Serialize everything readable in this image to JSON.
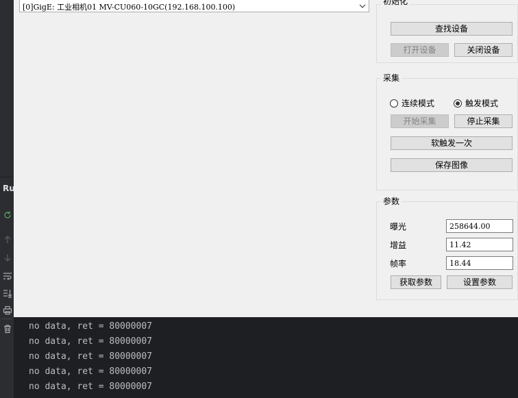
{
  "ide": {
    "run_label": "Ru"
  },
  "device": {
    "selected": "[0]GigE: 工业相机01 MV-CU060-10GC(192.168.100.100)"
  },
  "init_group": {
    "title": "初始化",
    "find_device": "查找设备",
    "open_device": "打开设备",
    "close_device": "关闭设备"
  },
  "acq_group": {
    "title": "采集",
    "continuous_mode": "连续模式",
    "trigger_mode": "触发模式",
    "start_grab": "开始采集",
    "stop_grab": "停止采集",
    "soft_trigger": "软触发一次",
    "save_image": "保存图像"
  },
  "param_group": {
    "title": "参数",
    "exposure_label": "曝光",
    "exposure_value": "258644.00",
    "gain_label": "增益",
    "gain_value": "11.42",
    "fps_label": "帧率",
    "fps_value": "18.44",
    "get_params": "获取参数",
    "set_params": "设置参数"
  },
  "console": {
    "lines": [
      "no data, ret = 80000007",
      "no data, ret = 80000007",
      "no data, ret = 80000007",
      "no data, ret = 80000007",
      "no data, ret = 80000007"
    ]
  },
  "colors": {
    "ide_bg": "#2b2d30",
    "console_bg": "#1e1f22",
    "console_text": "#bcbec4",
    "window_bg": "#f0f0f0",
    "button_bg": "#e1e1e1",
    "button_disabled_bg": "#cccccc"
  },
  "icons": {
    "rerun": "rerun-icon",
    "up": "arrow-up-icon",
    "down": "arrow-down-icon",
    "wrap": "soft-wrap-icon",
    "scroll_end": "scroll-to-end-icon",
    "print": "print-icon",
    "trash": "trash-icon",
    "combo_arrow": "chevron-down-icon"
  }
}
